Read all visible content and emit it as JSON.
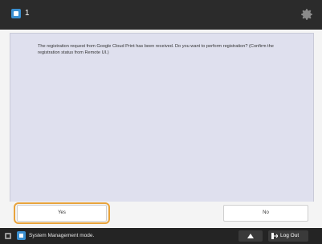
{
  "topbar": {
    "title_number": "1",
    "app_icon": "copier-app-icon",
    "settings_icon": "gear-icon"
  },
  "dialog": {
    "message": "The registration request from Google Cloud Print has been received. Do you want to perform registration? (Confirm the registration status from Remote UI.)"
  },
  "buttons": {
    "yes_label": "Yes",
    "no_label": "No"
  },
  "statusbar": {
    "mode_label": "System Management mode.",
    "logout_label": "Log Out",
    "up_icon": "arrow-up-icon",
    "logout_icon": "logout-icon",
    "status_icon": "status-icon"
  },
  "colors": {
    "dialog_bg": "#dfe0ee",
    "accent": "#3a8fd0",
    "highlight": "#e8a33c",
    "topbar_bg": "#2b2b2b"
  }
}
